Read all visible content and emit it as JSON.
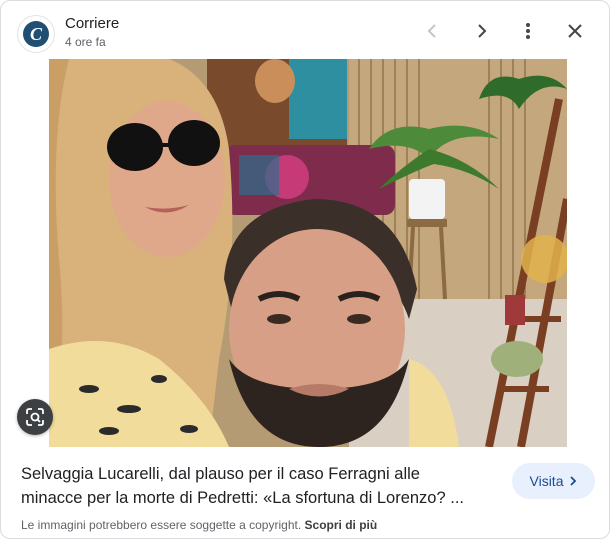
{
  "header": {
    "source": "Corriere",
    "time": "4 ore fa",
    "logo_letter": "C"
  },
  "controls": {
    "prev": "chevron-left-icon",
    "next": "chevron-right-icon",
    "more": "more-vert-icon",
    "close": "close-icon"
  },
  "article": {
    "title": "Selvaggia Lucarelli, dal plauso per il caso Ferragni alle\nminacce per la morte di Pedretti: «La sfortuna di Lorenzo? ...",
    "visit_label": "Visita"
  },
  "footer": {
    "notice": "Le immagini potrebbero essere soggette a copyright.",
    "link": "Scopri di più"
  },
  "colors": {
    "visit_bg": "#e8f0fe",
    "visit_text": "#1a4d8f",
    "logo": "#1f4f73"
  }
}
